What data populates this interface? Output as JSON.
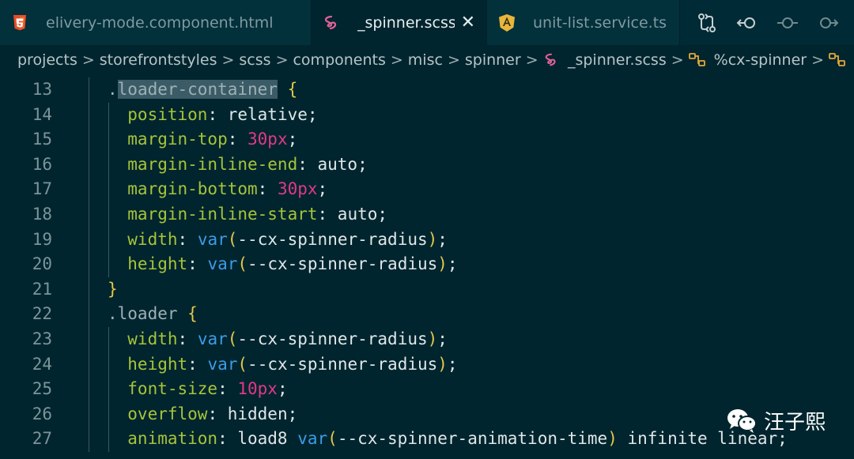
{
  "tabs": [
    {
      "label": "elivery-mode.component.html",
      "icon": "html5-icon",
      "active": false
    },
    {
      "label": "_spinner.scss",
      "icon": "sass-icon",
      "active": true
    },
    {
      "label": "unit-list.service.ts",
      "icon": "angular-icon",
      "active": false
    }
  ],
  "close_glyph": "✕",
  "breadcrumb": [
    "projects",
    "storefrontstyles",
    "scss",
    "components",
    "misc",
    "spinner",
    "_spinner.scss",
    "%cx-spinner"
  ],
  "breadcrumb_sep": ">",
  "code_lines": [
    {
      "n": "13",
      "indent": 1,
      "tokens": [
        {
          "t": ".",
          "c": "sel"
        },
        {
          "t": "loader-container",
          "c": "sel selhl"
        },
        {
          "t": " ",
          "c": "plain"
        },
        {
          "t": "{",
          "c": "brace"
        }
      ]
    },
    {
      "n": "14",
      "indent": 2,
      "tokens": [
        {
          "t": "  position",
          "c": "prop"
        },
        {
          "t": ": relative;",
          "c": "plain"
        }
      ]
    },
    {
      "n": "15",
      "indent": 2,
      "tokens": [
        {
          "t": "  margin-top",
          "c": "prop"
        },
        {
          "t": ": ",
          "c": "plain"
        },
        {
          "t": "30px",
          "c": "num"
        },
        {
          "t": ";",
          "c": "plain"
        }
      ]
    },
    {
      "n": "16",
      "indent": 2,
      "tokens": [
        {
          "t": "  margin-inline-end",
          "c": "prop"
        },
        {
          "t": ": auto;",
          "c": "plain"
        }
      ]
    },
    {
      "n": "17",
      "indent": 2,
      "tokens": [
        {
          "t": "  margin-bottom",
          "c": "prop"
        },
        {
          "t": ": ",
          "c": "plain"
        },
        {
          "t": "30px",
          "c": "num"
        },
        {
          "t": ";",
          "c": "plain"
        }
      ]
    },
    {
      "n": "18",
      "indent": 2,
      "tokens": [
        {
          "t": "  margin-inline-start",
          "c": "prop"
        },
        {
          "t": ": auto;",
          "c": "plain"
        }
      ]
    },
    {
      "n": "19",
      "indent": 2,
      "tokens": [
        {
          "t": "  width",
          "c": "prop"
        },
        {
          "t": ": ",
          "c": "plain"
        },
        {
          "t": "var",
          "c": "fn"
        },
        {
          "t": "(",
          "c": "brace"
        },
        {
          "t": "--cx-spinner-radius",
          "c": "plain"
        },
        {
          "t": ")",
          "c": "brace"
        },
        {
          "t": ";",
          "c": "plain"
        }
      ]
    },
    {
      "n": "20",
      "indent": 2,
      "tokens": [
        {
          "t": "  height",
          "c": "prop"
        },
        {
          "t": ": ",
          "c": "plain"
        },
        {
          "t": "var",
          "c": "fn"
        },
        {
          "t": "(",
          "c": "brace"
        },
        {
          "t": "--cx-spinner-radius",
          "c": "plain"
        },
        {
          "t": ")",
          "c": "brace"
        },
        {
          "t": ";",
          "c": "plain"
        }
      ]
    },
    {
      "n": "21",
      "indent": 1,
      "tokens": [
        {
          "t": "}",
          "c": "brace"
        }
      ]
    },
    {
      "n": "22",
      "indent": 1,
      "tokens": [
        {
          "t": ".loader ",
          "c": "sel"
        },
        {
          "t": "{",
          "c": "brace"
        }
      ]
    },
    {
      "n": "23",
      "indent": 2,
      "tokens": [
        {
          "t": "  width",
          "c": "prop"
        },
        {
          "t": ": ",
          "c": "plain"
        },
        {
          "t": "var",
          "c": "fn"
        },
        {
          "t": "(",
          "c": "brace"
        },
        {
          "t": "--cx-spinner-radius",
          "c": "plain"
        },
        {
          "t": ")",
          "c": "brace"
        },
        {
          "t": ";",
          "c": "plain"
        }
      ]
    },
    {
      "n": "24",
      "indent": 2,
      "tokens": [
        {
          "t": "  height",
          "c": "prop"
        },
        {
          "t": ": ",
          "c": "plain"
        },
        {
          "t": "var",
          "c": "fn"
        },
        {
          "t": "(",
          "c": "brace"
        },
        {
          "t": "--cx-spinner-radius",
          "c": "plain"
        },
        {
          "t": ")",
          "c": "brace"
        },
        {
          "t": ";",
          "c": "plain"
        }
      ]
    },
    {
      "n": "25",
      "indent": 2,
      "tokens": [
        {
          "t": "  font-size",
          "c": "prop"
        },
        {
          "t": ": ",
          "c": "plain"
        },
        {
          "t": "10px",
          "c": "num"
        },
        {
          "t": ";",
          "c": "plain"
        }
      ]
    },
    {
      "n": "26",
      "indent": 2,
      "tokens": [
        {
          "t": "  overflow",
          "c": "prop"
        },
        {
          "t": ": hidden;",
          "c": "plain"
        }
      ]
    },
    {
      "n": "27",
      "indent": 2,
      "tokens": [
        {
          "t": "  animation",
          "c": "prop"
        },
        {
          "t": ": load8 ",
          "c": "plain"
        },
        {
          "t": "var",
          "c": "fn"
        },
        {
          "t": "(",
          "c": "brace"
        },
        {
          "t": "--cx-spinner-animation-time",
          "c": "plain"
        },
        {
          "t": ")",
          "c": "brace"
        },
        {
          "t": " infinite linear;",
          "c": "plain"
        }
      ]
    }
  ],
  "watermark": {
    "text": "汪子熙",
    "icon": "wechat-icon"
  },
  "colors": {
    "background": "#00252e",
    "property": "#a6c43b",
    "number": "#e0398a",
    "function": "#3d9be8",
    "brace": "#e3c84a"
  }
}
